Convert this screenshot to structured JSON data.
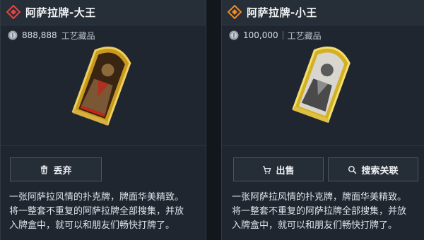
{
  "left_card": {
    "title": "阿萨拉牌-大王",
    "price": "888,888",
    "category": "工艺藏品",
    "rarity_color": "#e8453c",
    "buttons": {
      "discard_label": "丢弃"
    },
    "description_lines": [
      "一张阿萨拉风情的扑克牌，牌面华美精致。",
      "将一整套不重复的阿萨拉牌全部搜集，并放",
      "入牌盒中，就可以和朋友们畅快打牌了。"
    ]
  },
  "right_card": {
    "title": "阿萨拉牌-小王",
    "price": "100,000",
    "category": "工艺藏品",
    "rarity_color": "#f08a24",
    "buttons": {
      "sell_label": "出售",
      "search_label": "搜索关联"
    },
    "description_lines": [
      "一张阿萨拉风情的扑克牌，牌面华美精致。",
      "将一整套不重复的阿萨拉牌全部搜集，并放",
      "入牌盒中，就可以和朋友们畅快打牌了。"
    ]
  },
  "icons": {
    "rarity": "diamond-rarity-icon",
    "currency": "coin-icon",
    "discard": "trash-icon",
    "sell": "cart-icon",
    "search": "magnifier-icon"
  }
}
